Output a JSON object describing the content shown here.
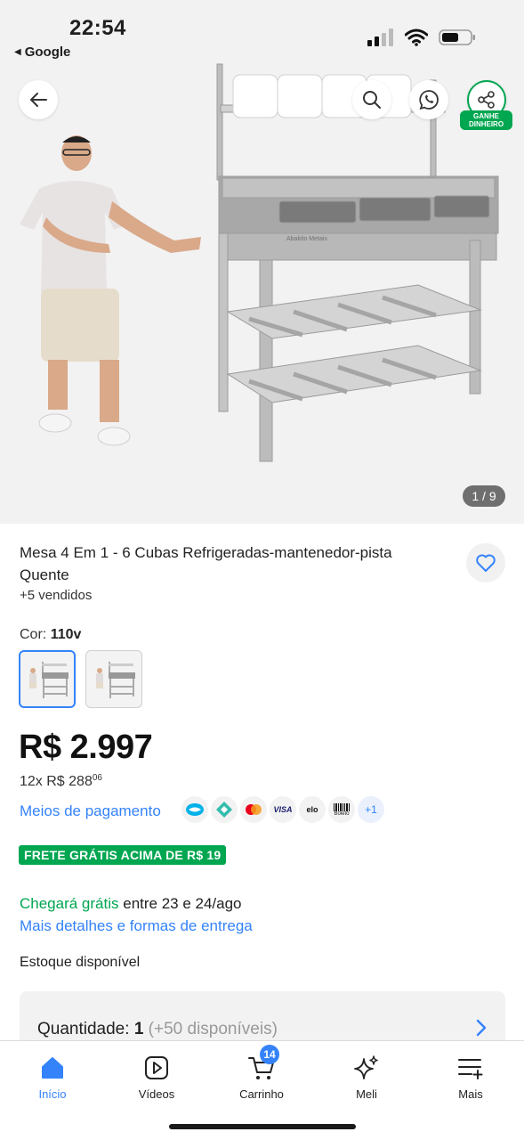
{
  "status_bar": {
    "time": "22:54",
    "back_app": "Google"
  },
  "hero": {
    "page_counter": "1 / 9",
    "earn_badge": "GANHE DINHEIRO",
    "product_label": "Abakito Metais"
  },
  "product": {
    "title": "Mesa 4 Em 1 - 6 Cubas Refrigeradas-mantenedor-pista Quente",
    "sold": "+5 vendidos",
    "color_label": "Cor:",
    "color_value": "110v",
    "price": "R$ 2.997",
    "installments_prefix": "12x R$ 288",
    "installments_cents": "06",
    "payment_link": "Meios de pagamento",
    "payment_methods": [
      "mercado-pago-icon",
      "pix-icon",
      "mastercard-icon",
      "visa-icon",
      "elo-icon",
      "boleto-icon"
    ],
    "payment_visa": "VISA",
    "payment_elo": "elo",
    "payment_boleto": "Boleto",
    "payment_more": "+1",
    "free_shipping": "FRETE GRÁTIS ACIMA DE R$ 19",
    "arrival_green": "Chegará grátis",
    "arrival_rest": " entre 23 e 24/ago",
    "delivery_link": "Mais detalhes e formas de entrega",
    "stock": "Estoque disponível",
    "quantity_label": "Quantidade:",
    "quantity_value": "1",
    "quantity_available": "(+50 disponíveis)"
  },
  "nav": {
    "home": "Início",
    "videos": "Vídeos",
    "cart": "Carrinho",
    "cart_count": "14",
    "meli": "Meli",
    "more": "Mais"
  },
  "colors": {
    "accent": "#3483fa",
    "green": "#00a650"
  }
}
